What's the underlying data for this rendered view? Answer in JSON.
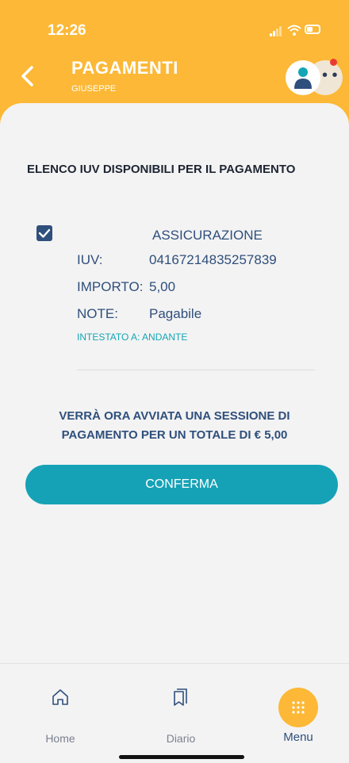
{
  "status_bar": {
    "time": "12:26"
  },
  "header": {
    "title": "PAGAMENTI",
    "subtitle": "GIUSEPPE"
  },
  "main": {
    "section_title": "ELENCO IUV DISPONIBILI PER IL PAGAMENTO",
    "item": {
      "checked": true,
      "type": "ASSICURAZIONE",
      "iuv_label": "IUV:",
      "iuv_value": "04167214835257839",
      "importo_label": "IMPORTO:",
      "importo_value": "5,00",
      "note_label": "NOTE:",
      "note_value": "Pagabile",
      "intestato": "INTESTATO A: ANDANTE"
    },
    "summary_line1": "VERRÀ ORA AVVIATA UNA SESSIONE DI",
    "summary_line2": "PAGAMENTO PER UN TOTALE DI € 5,00",
    "confirm_label": "CONFERMA"
  },
  "tabbar": {
    "items": [
      {
        "label": "Home",
        "icon": "home-icon"
      },
      {
        "label": "Diario",
        "icon": "diary-icon"
      },
      {
        "label": "Menu",
        "icon": "menu-grid-icon"
      }
    ]
  },
  "colors": {
    "accent": "#fcb836",
    "primary": "#2f4f7c",
    "teal": "#16a2b6"
  }
}
